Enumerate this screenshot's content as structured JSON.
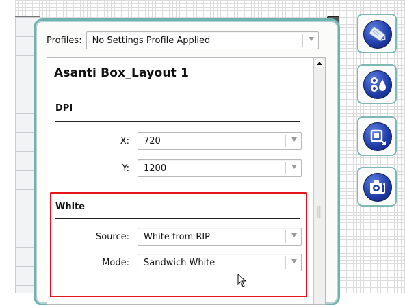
{
  "profiles": {
    "label": "Profiles:",
    "value": "No Settings Profile Applied"
  },
  "document": {
    "title": "Asanti Box_Layout 1"
  },
  "dpi": {
    "section_title": "DPI",
    "x_label": "X:",
    "x_value": "720",
    "y_label": "Y:",
    "y_value": "1200"
  },
  "white": {
    "section_title": "White",
    "source_label": "Source:",
    "source_value": "White from RIP",
    "mode_label": "Mode:",
    "mode_value": "Sandwich White",
    "highlight_color": "#e8141c"
  },
  "toolbar": {
    "buttons": [
      {
        "icon": "tag-icon"
      },
      {
        "icon": "ink-settings-icon"
      },
      {
        "icon": "resize-icon"
      },
      {
        "icon": "camera-icon"
      }
    ]
  },
  "colors": {
    "panel_border": "#6fb3b0",
    "icon_blue": "#1d3aa6"
  }
}
